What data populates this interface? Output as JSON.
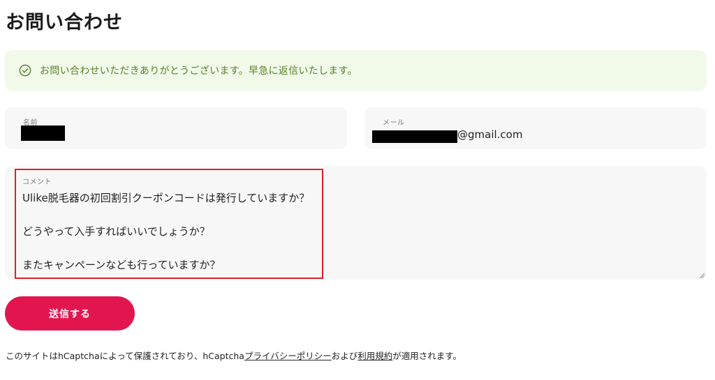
{
  "page": {
    "title": "お問い合わせ"
  },
  "success": {
    "message": "お問い合わせいただきありがとうございます。早急に返信いたします。",
    "icon": "check-circle-icon",
    "color": "#5a7f29"
  },
  "form": {
    "name": {
      "label": "名前",
      "value": ""
    },
    "email": {
      "label": "メール",
      "value_suffix": "@gmail.com"
    },
    "comment": {
      "label": "コメント",
      "lines": [
        "Ulike脱毛器の初回割引クーポンコードは発行していますか？",
        "",
        "どうやって入手すればいいでしょうか？",
        "",
        "またキャンペーンなども行っていますか？"
      ]
    },
    "submit_label": "送信する",
    "submit_color": "#e3154f"
  },
  "footer": {
    "text_1": "このサイトはhCaptchaによって保護されており、hCaptcha",
    "privacy_link": "プライバシーポリシー",
    "text_2": "および",
    "terms_link": "利用規約",
    "text_3": "が適用されます。"
  }
}
